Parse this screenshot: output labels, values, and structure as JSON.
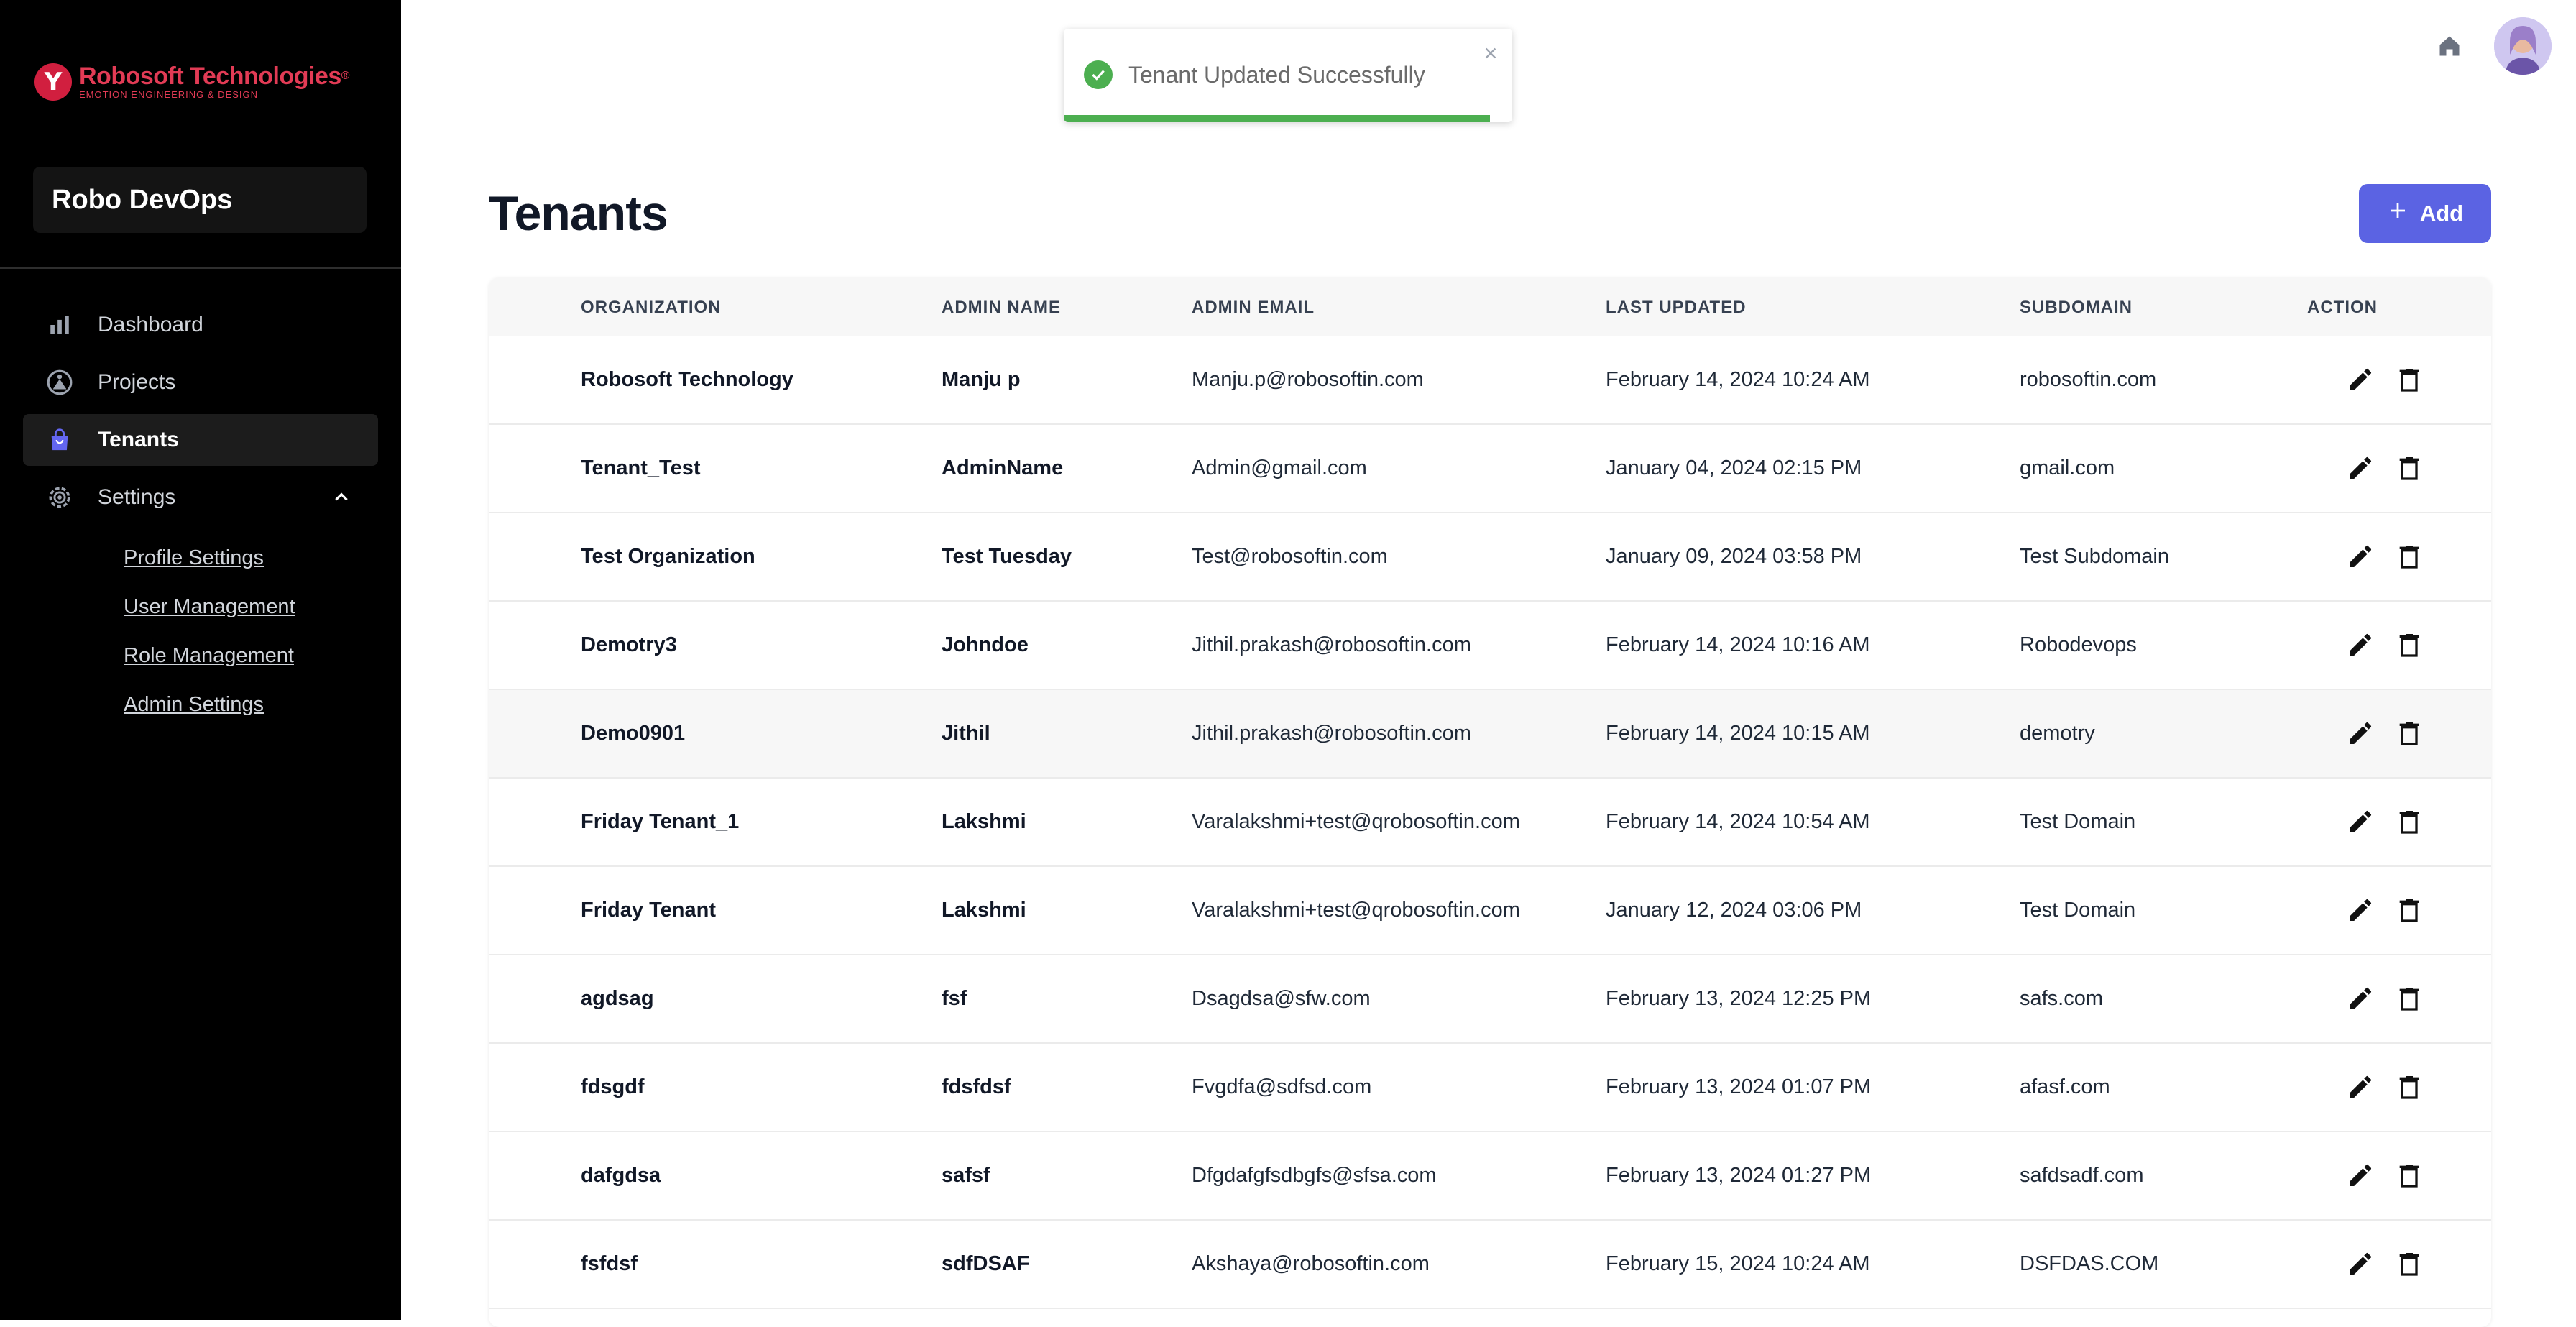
{
  "brand": {
    "logo_letter": "Y",
    "name": "Robosoft Technologies",
    "registered": "®",
    "tagline": "EMOTION ENGINEERING & DESIGN",
    "color": "#e23b55"
  },
  "workspace": {
    "name": "Robo DevOps"
  },
  "sidebar": {
    "items": [
      {
        "label": "Dashboard",
        "icon": "bar-chart-icon"
      },
      {
        "label": "Projects",
        "icon": "projects-icon"
      },
      {
        "label": "Tenants",
        "icon": "shopping-bag-icon",
        "active": true
      },
      {
        "label": "Settings",
        "icon": "gear-icon",
        "expanded": true
      }
    ],
    "settings_sub": [
      "Profile Settings",
      "User Management",
      "Role Management",
      "Admin Settings"
    ]
  },
  "toast": {
    "message": "Tenant Updated Successfully",
    "type": "success",
    "progress": 0.95,
    "color": "#4caf50"
  },
  "header": {
    "home_icon": "home-icon",
    "avatar": "user-avatar"
  },
  "page": {
    "title": "Tenants",
    "add_label": "Add",
    "accent": "#5b63e3"
  },
  "table": {
    "columns": [
      "ORGANIZATION",
      "ADMIN NAME",
      "ADMIN EMAIL",
      "LAST UPDATED",
      "SUBDOMAIN",
      "ACTION"
    ],
    "rows": [
      [
        "Robosoft Technology",
        "Manju p",
        "Manju.p@robosoftin.com",
        "February 14, 2024 10:24 AM",
        "robosoftin.com"
      ],
      [
        "Tenant_Test",
        "AdminName",
        "Admin@gmail.com",
        "January 04, 2024 02:15 PM",
        "gmail.com"
      ],
      [
        "Test Organization",
        "Test Tuesday",
        "Test@robosoftin.com",
        "January 09, 2024 03:58 PM",
        "Test Subdomain"
      ],
      [
        "Demotry3",
        "Johndoe",
        "Jithil.prakash@robosoftin.com",
        "February 14, 2024 10:16 AM",
        "Robodevops"
      ],
      [
        "Demo0901",
        "Jithil",
        "Jithil.prakash@robosoftin.com",
        "February 14, 2024 10:15 AM",
        "demotry"
      ],
      [
        "Friday Tenant_1",
        "Lakshmi",
        "Varalakshmi+test@qrobosoftin.com",
        "February 14, 2024 10:54 AM",
        "Test Domain"
      ],
      [
        "Friday Tenant",
        "Lakshmi",
        "Varalakshmi+test@qrobosoftin.com",
        "January 12, 2024 03:06 PM",
        "Test Domain"
      ],
      [
        "agdsag",
        "fsf",
        "Dsagdsa@sfw.com",
        "February 13, 2024 12:25 PM",
        "safs.com"
      ],
      [
        "fdsgdf",
        "fdsfdsf",
        "Fvgdfa@sdfsd.com",
        "February 13, 2024 01:07 PM",
        "afasf.com"
      ],
      [
        "dafgdsa",
        "safsf",
        "Dfgdafgfsdbgfs@sfsa.com",
        "February 13, 2024 01:27 PM",
        "safdsadf.com"
      ],
      [
        "fsfdsf",
        "sdfDSAF",
        "Akshaya@robosoftin.com",
        "February 15, 2024 10:24 AM",
        "DSFDAS.COM"
      ]
    ],
    "hover_row": 4,
    "action_icons": [
      "edit-icon",
      "trash-icon"
    ]
  }
}
